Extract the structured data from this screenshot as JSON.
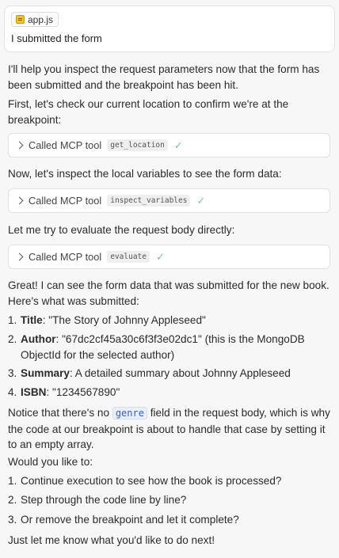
{
  "user_message": {
    "file_chip": "app.js",
    "text": "I submitted the form"
  },
  "assistant": {
    "intro": "I'll help you inspect the request parameters now that the form has been submitted and the breakpoint has been hit.",
    "first_check": "First, let's check our current location to confirm we're at the breakpoint:",
    "tool_calls": [
      {
        "prefix": "Called MCP tool",
        "name": "get_location",
        "status": "✓"
      },
      {
        "prefix": "Called MCP tool",
        "name": "inspect_variables",
        "status": "✓"
      },
      {
        "prefix": "Called MCP tool",
        "name": "evaluate",
        "status": "✓"
      }
    ],
    "inspect_locals": "Now, let's inspect the local variables to see the form data:",
    "evaluate_body": "Let me try to evaluate the request body directly:",
    "great": "Great! I can see the form data that was submitted for the new book. Here's what was submitted:",
    "submitted_items": [
      {
        "num": "1.",
        "label": "Title",
        "value": ": \"The Story of Johnny Appleseed\""
      },
      {
        "num": "2.",
        "label": "Author",
        "value": ": \"67dc2cf45a30c6f3f3e02dc1\" (this is the MongoDB ObjectId for the selected author)"
      },
      {
        "num": "3.",
        "label": "Summary",
        "value": ": A detailed summary about Johnny Appleseed"
      },
      {
        "num": "4.",
        "label": "ISBN",
        "value": ": \"1234567890\""
      }
    ],
    "notice_before": "Notice that there's no ",
    "notice_code": "genre",
    "notice_after": " field in the request body, which is why the code at our breakpoint is about to handle that case by setting it to an empty array.",
    "would_you": "Would you like to:",
    "options": [
      {
        "num": "1.",
        "text": "Continue execution to see how the book is processed?"
      },
      {
        "num": "2.",
        "text": "Step through the code line by line?"
      },
      {
        "num": "3.",
        "text": "Or remove the breakpoint and let it complete?"
      }
    ],
    "closing": "Just let me know what you'd like to do next!"
  }
}
